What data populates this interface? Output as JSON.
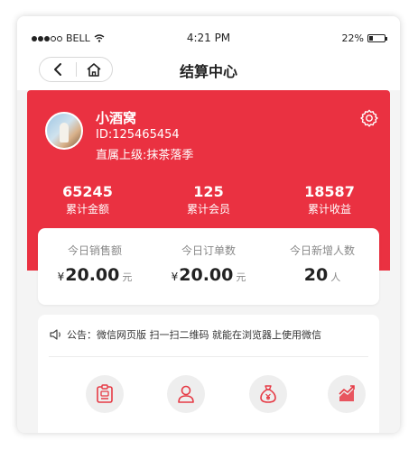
{
  "status_bar": {
    "carrier": "BELL",
    "time": "4:21 PM",
    "battery_percent": "22%",
    "battery_level": 0.22,
    "signal_bars": 3
  },
  "nav": {
    "title": "结算中心",
    "back_icon": "chevron-left-icon",
    "home_icon": "home-icon"
  },
  "profile": {
    "name": "小酒窝",
    "id": "ID:125465454",
    "upline": "直属上级:抹茶落季",
    "settings_icon": "gear-icon"
  },
  "stats": [
    {
      "value": "65245",
      "label": "累计金额"
    },
    {
      "value": "125",
      "label": "累计会员"
    },
    {
      "value": "18587",
      "label": "累计收益"
    }
  ],
  "today": [
    {
      "label": "今日销售额",
      "prefix": "¥",
      "value": "20.00",
      "unit": "元"
    },
    {
      "label": "今日订单数",
      "prefix": "¥",
      "value": "20.00",
      "unit": "元"
    },
    {
      "label": "今日新增人数",
      "prefix": "",
      "value": "20",
      "unit": "人"
    }
  ],
  "notice": {
    "icon": "speaker-icon",
    "text": "公告：微信网页版 扫一扫二维码 就能在浏览器上使用微信"
  },
  "shortcut_icons": [
    "id-card-icon",
    "user-icon",
    "money-bag-icon",
    "trend-chart-icon"
  ],
  "colors": {
    "brand_red": "#ea3141",
    "background": "#f4f4f4",
    "card": "#ffffff"
  }
}
